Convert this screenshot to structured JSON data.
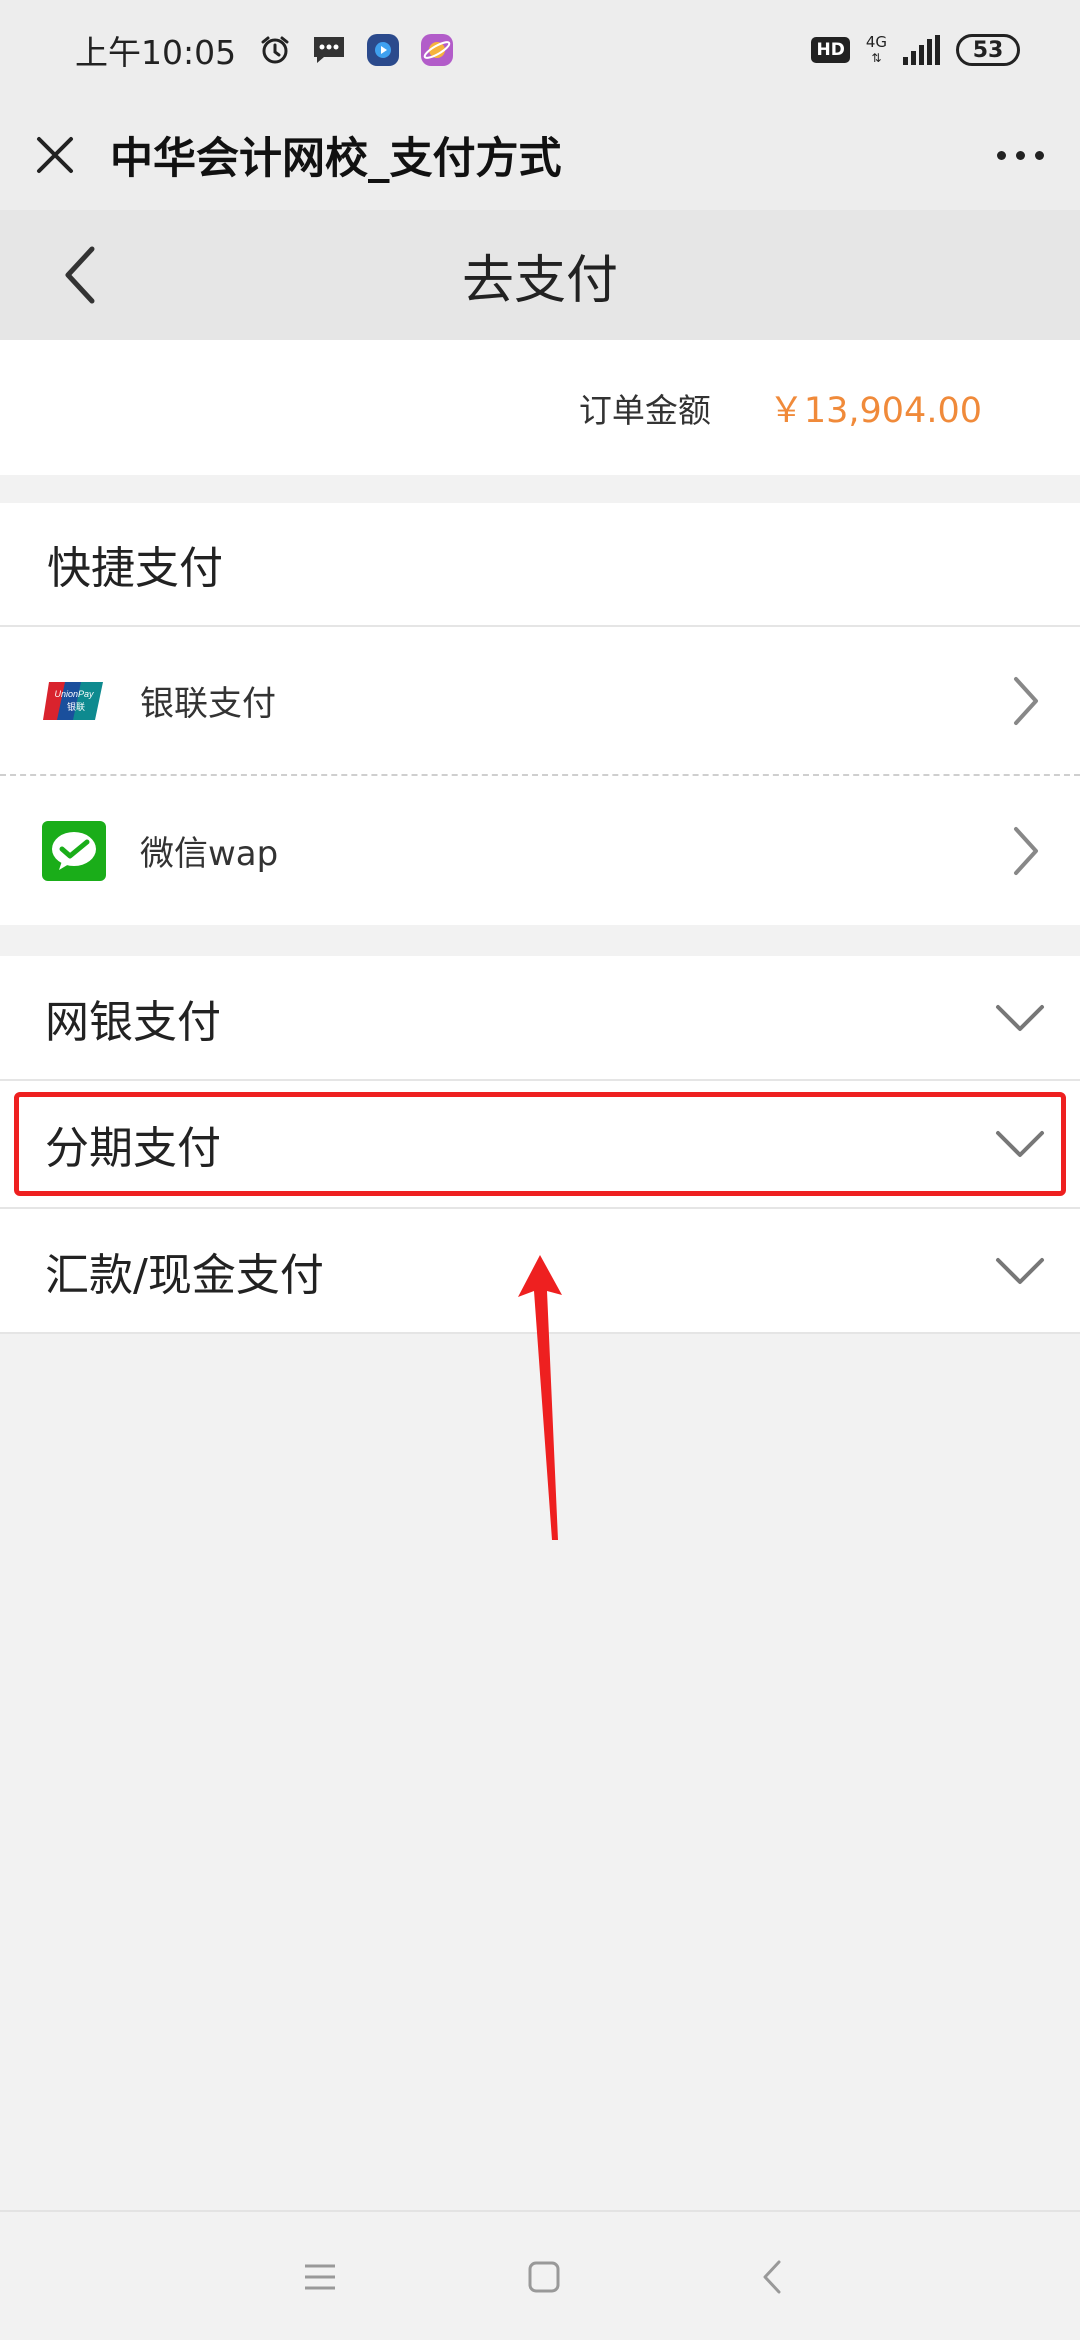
{
  "status_bar": {
    "time": "上午10:05",
    "hd": "HD",
    "network": "4G",
    "battery": "53",
    "icons": [
      "alarm-icon",
      "message-icon",
      "video-app-icon",
      "planet-app-icon"
    ]
  },
  "browser": {
    "title": "中华会计网校_支付方式",
    "close_icon": "close-icon",
    "more_icon": "more-icon"
  },
  "header": {
    "title": "去支付",
    "back_icon": "chevron-left-icon"
  },
  "order": {
    "label": "订单金额",
    "amount": "￥13,904.00",
    "amount_color": "#f08a3a"
  },
  "quick_pay": {
    "title": "快捷支付",
    "items": [
      {
        "label": "银联支付",
        "icon": "unionpay-icon"
      },
      {
        "label": "微信wap",
        "icon": "wechat-icon"
      }
    ]
  },
  "sections": [
    {
      "label": "网银支付",
      "icon": "chevron-down-icon"
    },
    {
      "label": "分期支付",
      "icon": "chevron-down-icon",
      "highlighted": true
    },
    {
      "label": "汇款/现金支付",
      "icon": "chevron-down-icon"
    }
  ],
  "annotation_color": "#ee2020",
  "nav": [
    "menu-icon",
    "home-icon",
    "back-icon"
  ]
}
